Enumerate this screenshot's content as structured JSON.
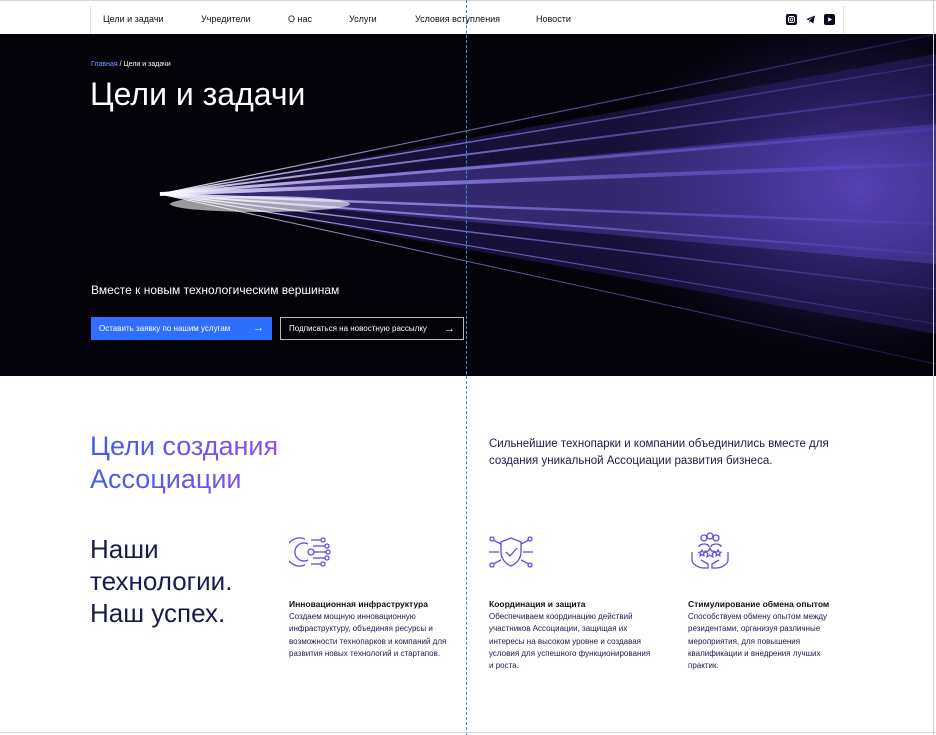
{
  "nav": {
    "links": [
      "Цели и задачи",
      "Учредители",
      "О нас",
      "Услуги",
      "Условия вступления",
      "Новости"
    ],
    "social": [
      "instagram-icon",
      "telegram-icon",
      "youtube-icon"
    ]
  },
  "hero": {
    "breadcrumb_home": "Главная",
    "breadcrumb_sep": " / ",
    "breadcrumb_current": "Цели и задачи",
    "title": "Цели и задачи",
    "subtitle": "Вместе к новым технологическим вершинам",
    "btn_primary": "Оставить заявку по нашим услугам",
    "btn_secondary": "Подписаться на новостную рассылку",
    "arrow": "→"
  },
  "goals": {
    "title_line1": "Цели создания",
    "title_line2": "Ассоциации",
    "intro": "Сильнейшие технопарки и компании объединились вместе для создания уникальной Ассоциации развития бизнеса.",
    "slogan_line1": "Наши",
    "slogan_line2": "технологии.",
    "slogan_line3": "Наш успех."
  },
  "features": [
    {
      "icon": "infrastructure-icon",
      "title": "Инновационная инфраструктура",
      "text": "Создаем мощную инновационную инфраструктуру, объединяя ресурсы и возможности технопарков и компаний для развития новых технологий и стартапов."
    },
    {
      "icon": "shield-check-icon",
      "title": "Координация и защита",
      "text": "Обеспечиваем координацию действий участников Ассоциации, защищая их интересы на высоком уровне и создавая условия для успешного функционирования и роста."
    },
    {
      "icon": "community-hands-icon",
      "title": "Стимулирование обмена опытом",
      "text": "Способствуем обмену опытом между резидентами, организуя различные мероприятия, для повышения квалификации и внедрения лучших практик."
    }
  ],
  "colors": {
    "accent": "#2f6fff",
    "title_gradient_start": "#3f5ce8",
    "title_gradient_end": "#8d4ff0",
    "text_dark": "#1a1a4d"
  }
}
